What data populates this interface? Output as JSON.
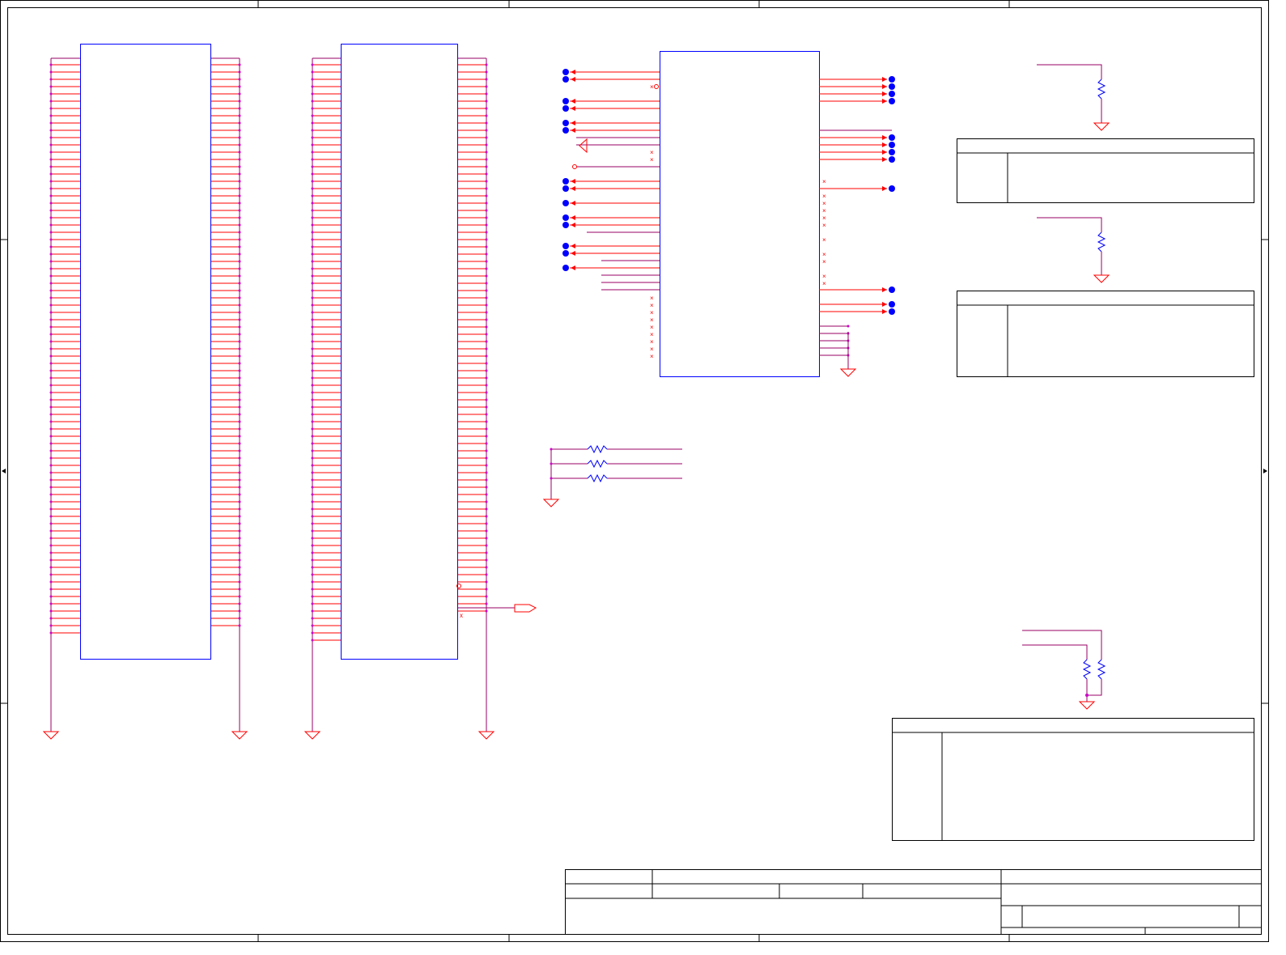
{
  "sheet": {
    "title": "",
    "colors": {
      "frame": "#000000",
      "part_outline": "#0000ff",
      "wire": "#ff0000",
      "net": "#990066",
      "junction": "#cc00cc",
      "port_dot": "#0000ff",
      "ground": "#ff0000",
      "resistor": "#0000ff"
    },
    "icons": {
      "ground": "ground-icon",
      "resistor": "resistor-icon",
      "port": "port-dot-icon",
      "no_connect": "no-connect-icon",
      "output_port": "output-port-icon"
    }
  },
  "components": {
    "connector_a": {
      "label": "",
      "pin_rows": 80
    },
    "connector_b": {
      "label": "",
      "pin_rows": 80
    },
    "ic_main": {
      "label": ""
    },
    "resistor_network": {
      "count": 3
    }
  },
  "notes_tables": [
    {
      "title": "",
      "body": ""
    },
    {
      "title": "",
      "body": ""
    },
    {
      "title": "",
      "body": ""
    }
  ],
  "title_block": {
    "title": "",
    "size": "",
    "document_number": "",
    "rev": "",
    "date": "",
    "sheet": ""
  }
}
